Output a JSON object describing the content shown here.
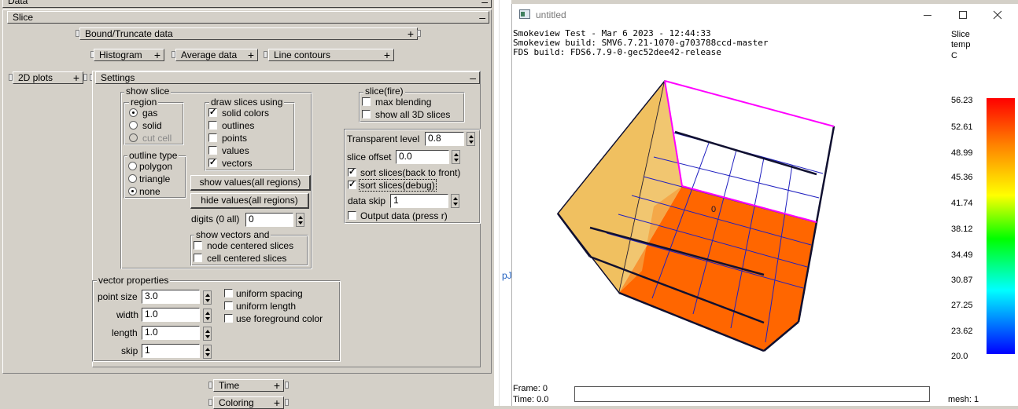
{
  "panel": {
    "data_header": "Data",
    "slice_header": "Slice",
    "bound_truncate": "Bound/Truncate data",
    "histogram": "Histogram",
    "average_data": "Average data",
    "line_contours": "Line contours",
    "plots_2d": "2D plots",
    "settings": "Settings",
    "time": "Time",
    "coloring": "Coloring",
    "show_slice": {
      "title": "show slice",
      "region": {
        "title": "region",
        "options": [
          "gas",
          "solid",
          "cut cell"
        ],
        "selected": "gas"
      },
      "outline_type": {
        "title": "outline type",
        "options": [
          "polygon",
          "triangle",
          "none"
        ],
        "selected": "none"
      },
      "draw_slices_using": {
        "title": "draw slices using",
        "options": [
          {
            "label": "solid colors",
            "checked": true
          },
          {
            "label": "outlines",
            "checked": false
          },
          {
            "label": "points",
            "checked": false
          },
          {
            "label": "values",
            "checked": false
          },
          {
            "label": "vectors",
            "checked": true
          }
        ]
      },
      "show_values_btn": "show values(all regions)",
      "hide_values_btn": "hide values(all regions)",
      "digits_label": "digits (0 all)",
      "digits_value": "0",
      "show_vectors": {
        "title": "show vectors and",
        "node_centered": "node centered slices",
        "cell_centered": "cell centered slices"
      }
    },
    "slice_fire": {
      "title": "slice(fire)",
      "max_blending": "max blending",
      "show_all_3d": "show all 3D slices"
    },
    "transparency": {
      "transparent_level_label": "Transparent level",
      "transparent_level_value": "0.8",
      "slice_offset_label": "slice offset",
      "slice_offset_value": "0.0",
      "sort_back_to_front": "sort slices(back to front)",
      "sort_debug": "sort slices(debug)",
      "data_skip_label": "data skip",
      "data_skip_value": "1",
      "output_data": "Output data (press r)"
    },
    "vector_properties": {
      "title": "vector properties",
      "point_size_label": "point size",
      "point_size_value": "3.0",
      "width_label": "width",
      "width_value": "1.0",
      "length_label": "length",
      "length_value": "1.0",
      "skip_label": "skip",
      "skip_value": "1",
      "uniform_spacing": "uniform spacing",
      "uniform_length": "uniform length",
      "use_foreground_color": "use foreground color"
    }
  },
  "background_fragment": "pJ",
  "smokeview": {
    "window_title": "untitled",
    "info_lines": [
      "Smokeview  Test - Mar  6 2023 - 12:44:33",
      "Smokeview build: SMV6.7.21-1070-g703788ccd-master",
      "FDS build: FDS6.7.9-0-gec52dee42-release"
    ],
    "colorbar": {
      "title": [
        "Slice",
        "temp",
        "C"
      ],
      "labels": [
        "56.23",
        "52.61",
        "48.99",
        "45.36",
        "41.74",
        "38.12",
        "34.49",
        "30.87",
        "27.25",
        "23.62",
        "20.0"
      ],
      "gradient": [
        "#ff0000",
        "#ff8000",
        "#ffff00",
        "#00ff00",
        "#00ffff",
        "#0000ff"
      ]
    },
    "scene_label": "0",
    "frame_label": "Frame: 0",
    "time_label": "Time: 0.0",
    "mesh_label": "mesh: 1",
    "colors": {
      "slice_fill": "#ff6600",
      "wall": "#f0c060",
      "grid_line": "#2020c0",
      "outline": "#101030",
      "magenta": "#ff00ff"
    }
  }
}
